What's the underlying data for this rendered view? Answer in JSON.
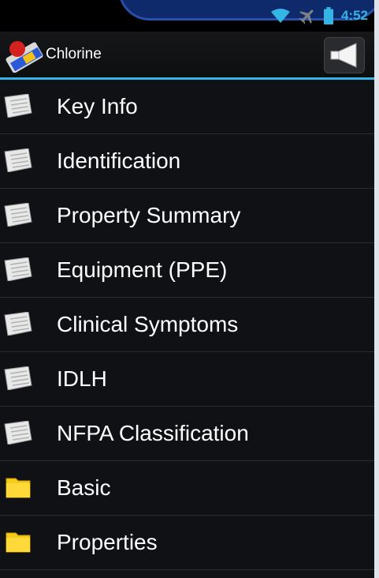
{
  "status_bar": {
    "time": "4:52",
    "icons": [
      "wifi-icon",
      "airplane-mode-icon",
      "battery-icon"
    ],
    "accent_color": "#33b5e5"
  },
  "action_bar": {
    "title": "Chlorine",
    "app_icon": "hazmat-app-icon",
    "action_icon": "speaker-icon",
    "accent_color": "#33b5e5"
  },
  "menu": {
    "items": [
      {
        "label": "Key Info",
        "icon": "document-icon"
      },
      {
        "label": "Identification",
        "icon": "document-icon"
      },
      {
        "label": "Property Summary",
        "icon": "document-icon"
      },
      {
        "label": "Equipment (PPE)",
        "icon": "document-icon"
      },
      {
        "label": "Clinical Symptoms",
        "icon": "document-icon"
      },
      {
        "label": "IDLH",
        "icon": "document-icon"
      },
      {
        "label": "NFPA Classification",
        "icon": "document-icon"
      },
      {
        "label": "Basic",
        "icon": "folder-icon"
      },
      {
        "label": "Properties",
        "icon": "folder-icon"
      }
    ]
  }
}
